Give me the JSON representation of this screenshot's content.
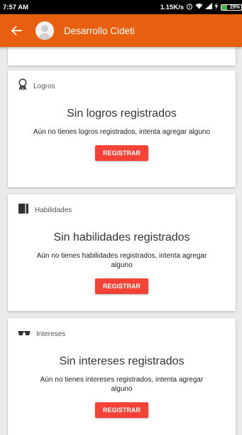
{
  "status_bar": {
    "time": "7:57 AM",
    "speed": "1.15K/s",
    "battery": "29%"
  },
  "app_bar": {
    "title": "Desarrollo Cideti"
  },
  "cards": [
    {
      "label": "Logros",
      "title": "Sin logros registrados",
      "description": "Aún no tienes logros registrados, intenta agregar alguno",
      "button": "REGISTRAR"
    },
    {
      "label": "Habilidades",
      "title": "Sin habilidades registrados",
      "description": "Aún no tienes habilidades registrados, intenta agregar alguno",
      "button": "REGISTRAR"
    },
    {
      "label": "Intereses",
      "title": "Sin intereses registrados",
      "description": "Aún no tienes intereses registrados, intenta agregar alguno",
      "button": "REGISTRAR"
    }
  ],
  "colors": {
    "app_bar": "#e8600f",
    "button": "#f44336",
    "background": "#ebebeb"
  }
}
